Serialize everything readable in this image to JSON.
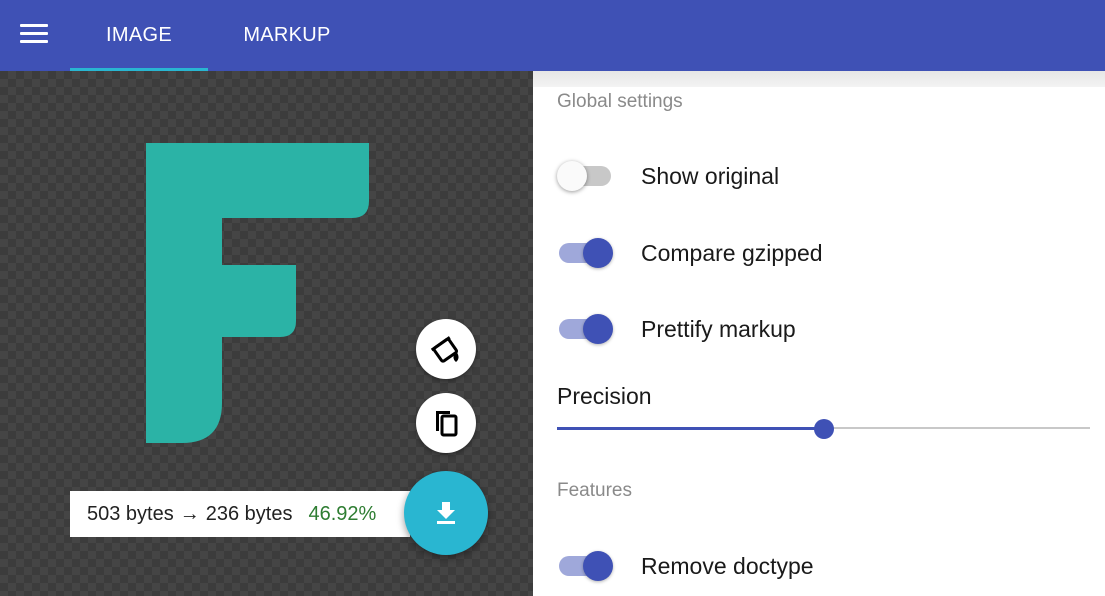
{
  "header": {
    "tabs": [
      {
        "label": "IMAGE",
        "active": true
      },
      {
        "label": "MARKUP",
        "active": false
      }
    ],
    "menu_icon": "hamburger-menu-icon",
    "bar_color": "#3f51b5",
    "accent_color": "#29b6d1"
  },
  "preview": {
    "letter_color": "#2bb3a6",
    "actions": [
      {
        "icon": "format-color-fill-icon"
      },
      {
        "icon": "copy-icon"
      },
      {
        "icon": "download-icon"
      }
    ]
  },
  "results": {
    "original": "503 bytes",
    "arrow": "→",
    "optimized": "236 bytes",
    "percent": "46.92%"
  },
  "settings": {
    "global_title": "Global settings",
    "show_original": {
      "label": "Show original",
      "checked": false
    },
    "compare_gzipped": {
      "label": "Compare gzipped",
      "checked": true
    },
    "prettify_markup": {
      "label": "Prettify markup",
      "checked": true
    },
    "precision": {
      "label": "Precision",
      "value_fraction": 0.5
    },
    "features_title": "Features",
    "remove_doctype": {
      "label": "Remove doctype",
      "checked": true
    }
  }
}
